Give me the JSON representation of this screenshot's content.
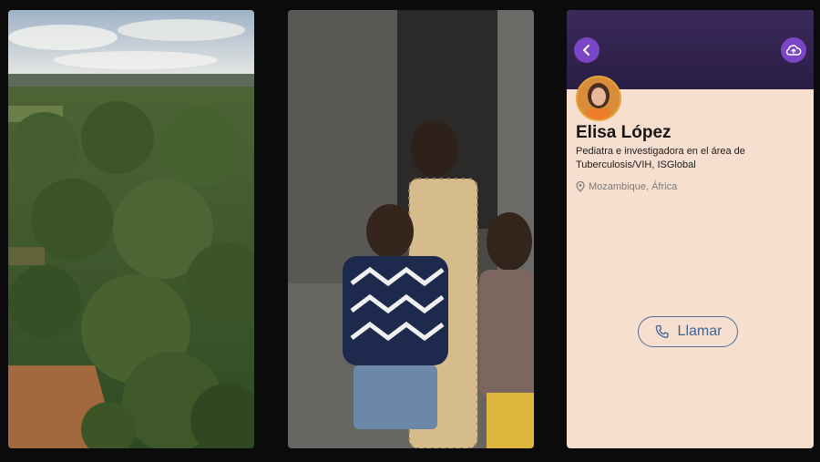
{
  "profile": {
    "name": "Elisa López",
    "role": "Pediatra e investigadora en el área de Tuberculosis/VIH, ISGlobal",
    "location": "Mozambique, África"
  },
  "actions": {
    "call_label": "Llamar"
  },
  "icons": {
    "back": "chevron-left-icon",
    "cloud": "cloud-upload-icon",
    "location": "map-pin-icon",
    "call": "phone-icon"
  },
  "colors": {
    "header": "#2a1d44",
    "accent": "#7a46c6",
    "card_bg": "#f6dfcf",
    "call_button": "#4e6e93"
  }
}
